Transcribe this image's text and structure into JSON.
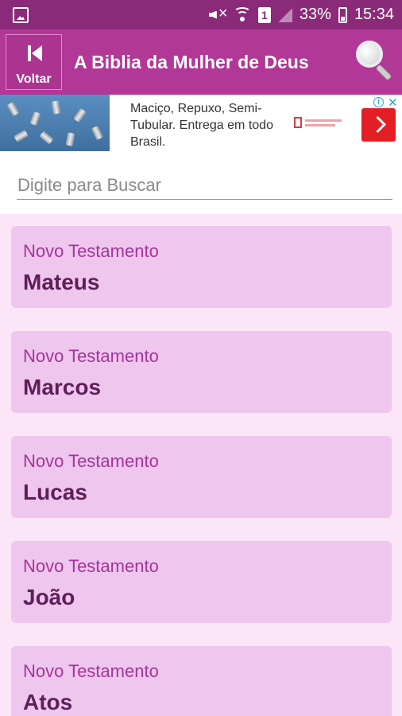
{
  "status_bar": {
    "battery": "33%",
    "sim": "1",
    "time": "15:34"
  },
  "header": {
    "back_label": "Voltar",
    "title": "A Biblia da Mulher de Deus"
  },
  "ad": {
    "text": "Maciço, Repuxo, Semi-Tubular. Entrega em todo Brasil."
  },
  "search": {
    "placeholder": "Digite para Buscar"
  },
  "books": [
    {
      "testament": "Novo Testamento",
      "name": "Mateus"
    },
    {
      "testament": "Novo Testamento",
      "name": "Marcos"
    },
    {
      "testament": "Novo Testamento",
      "name": "Lucas"
    },
    {
      "testament": "Novo Testamento",
      "name": "João"
    },
    {
      "testament": "Novo Testamento",
      "name": "Atos"
    }
  ],
  "colors": {
    "status_bar": "#8a2a78",
    "header": "#b23897",
    "card": "#eec6ee",
    "testament_text": "#a6349a",
    "book_text": "#5d1f58"
  }
}
